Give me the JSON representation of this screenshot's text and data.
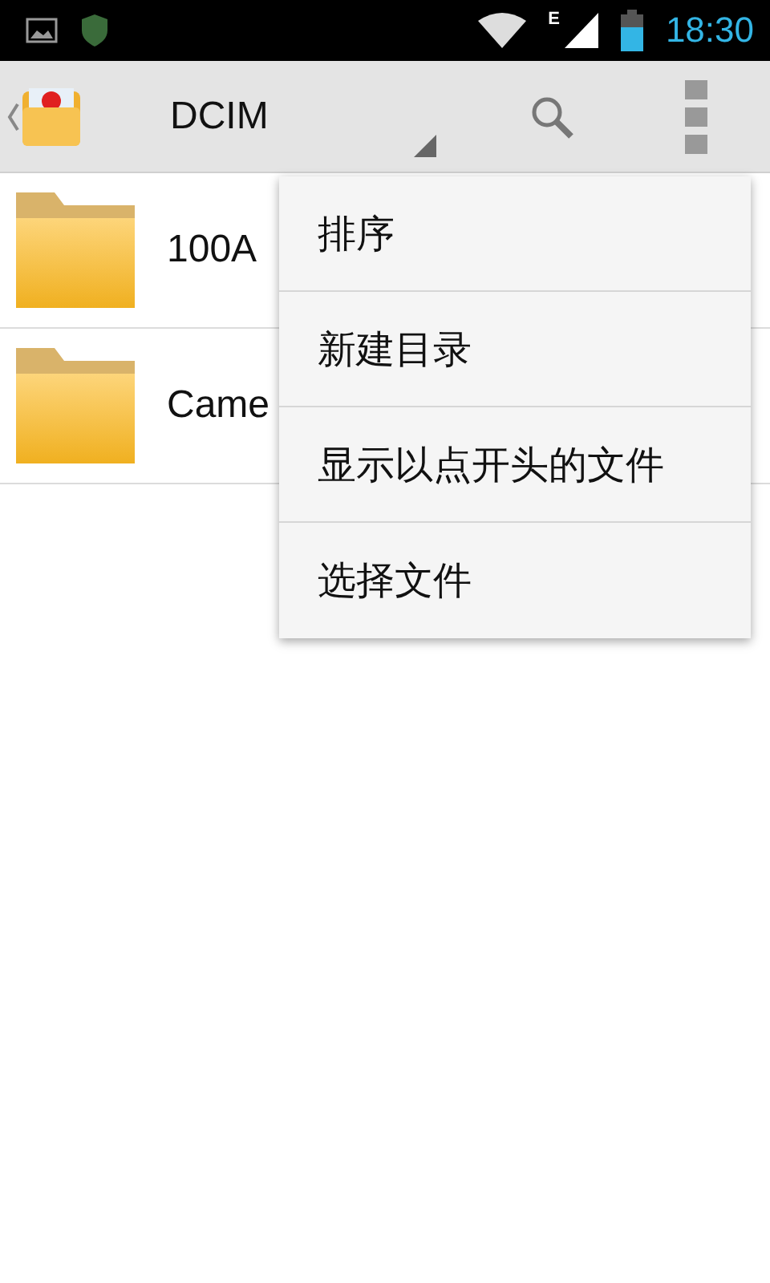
{
  "status_bar": {
    "time": "18:30",
    "network": "E"
  },
  "toolbar": {
    "title": "DCIM"
  },
  "files": [
    {
      "name": "100A"
    },
    {
      "name": "Came"
    }
  ],
  "menu": {
    "items": [
      {
        "label": "排序"
      },
      {
        "label": "新建目录"
      },
      {
        "label": "显示以点开头的文件"
      },
      {
        "label": "选择文件"
      }
    ]
  }
}
